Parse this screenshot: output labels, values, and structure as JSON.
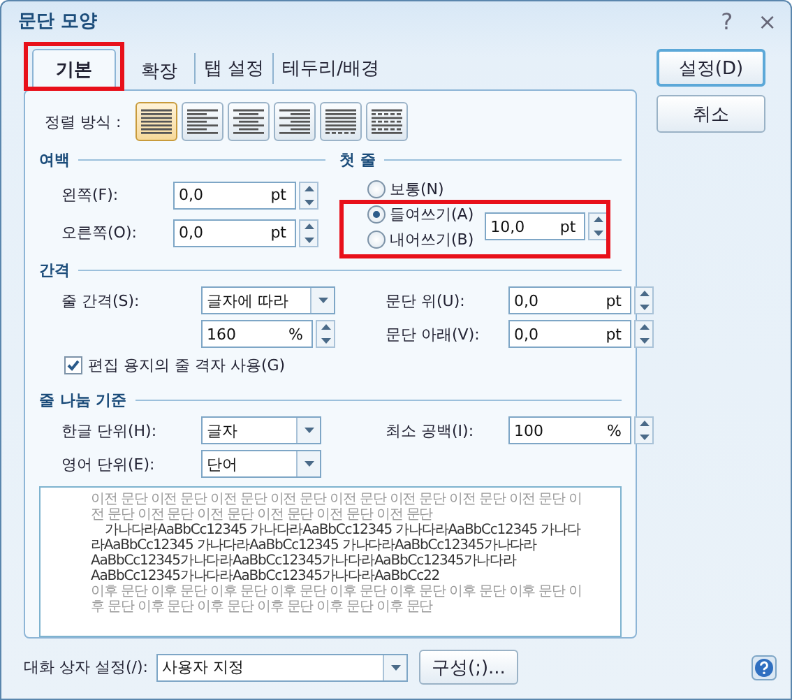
{
  "window": {
    "title": "문단 모양",
    "help": "?",
    "close": "×"
  },
  "tabs": [
    {
      "label": "기본",
      "selected": true,
      "highlighted": true
    },
    {
      "label": "확장",
      "selected": false,
      "highlighted": false
    },
    {
      "label": "탭 설정",
      "selected": false,
      "highlighted": false
    },
    {
      "label": "테두리/배경",
      "selected": false,
      "highlighted": false
    }
  ],
  "alignment": {
    "label": "정렬 방식 :",
    "options": [
      {
        "kind": "justify",
        "selected": true
      },
      {
        "kind": "left",
        "selected": false
      },
      {
        "kind": "center",
        "selected": false
      },
      {
        "kind": "right",
        "selected": false
      },
      {
        "kind": "distribute",
        "selected": false
      },
      {
        "kind": "divide",
        "selected": false
      }
    ]
  },
  "margins": {
    "title": "여백",
    "fields": [
      {
        "label": "왼쪽(F):",
        "value": "0,0",
        "unit": "pt"
      },
      {
        "label": "오른쪽(O):",
        "value": "0,0",
        "unit": "pt"
      }
    ]
  },
  "first_line": {
    "title": "첫 줄",
    "highlighted": true,
    "options": [
      {
        "label": "보통(N)",
        "selected": false
      },
      {
        "label": "들여쓰기(A)",
        "selected": true
      },
      {
        "label": "내어쓰기(B)",
        "selected": false
      }
    ],
    "field": {
      "value": "10,0",
      "unit": "pt"
    }
  },
  "spacing": {
    "title": "간격",
    "line_spacing": {
      "label": "줄 간격(S):",
      "dropdown": "글자에 따라",
      "value": "160",
      "unit": "%"
    },
    "para_fields": [
      {
        "label": "문단 위(U):",
        "value": "0,0",
        "unit": "pt"
      },
      {
        "label": "문단 아래(V):",
        "value": "0,0",
        "unit": "pt"
      }
    ],
    "grid": {
      "label": "편집 용지의 줄 격자 사용(G)",
      "checked": true
    }
  },
  "line_break": {
    "title": "줄 나눔 기준",
    "korean": {
      "label": "한글 단위(H):",
      "value": "글자"
    },
    "english": {
      "label": "영어 단위(E):",
      "value": "단어"
    },
    "min_space": {
      "label": "최소 공백(I):",
      "value": "100",
      "unit": "%"
    }
  },
  "preview": {
    "paragraphs": [
      {
        "kind": "before",
        "text": "이전 문단 이전 문단 이전 문단 이전 문단 이전 문단 이전 문단 이전 문단 이전 문단 이전 문단 이전 문단 이전 문단 이전 문단 이전 문단 이전 문단"
      },
      {
        "kind": "current",
        "text": "가나다라AaBbCc12345   가나다라AaBbCc12345   가나다라AaBbCc12345   가나다라AaBbCc12345   가나다라AaBbCc12345   가나다라AaBbCc12345가나다라AaBbCc12345가나다라AaBbCc12345가나다라AaBbCc12345가나다라AaBbCc12345가나다라AaBbCc12345가나다라AaBbCc22"
      },
      {
        "kind": "after",
        "text": "이후 문단 이후 문단 이후 문단 이후 문단 이후 문단 이후 문단 이후 문단 이후 문단 이후 문단 이후 문단 이후 문단 이후 문단 이후 문단 이후 문단"
      }
    ]
  },
  "buttons": [
    {
      "label": "설정(D)",
      "default": true
    },
    {
      "label": "취소",
      "default": false
    }
  ],
  "footer": {
    "label": "대화 상자 설정(/):",
    "value": "사용자 지정",
    "button": "구성(;)..."
  }
}
